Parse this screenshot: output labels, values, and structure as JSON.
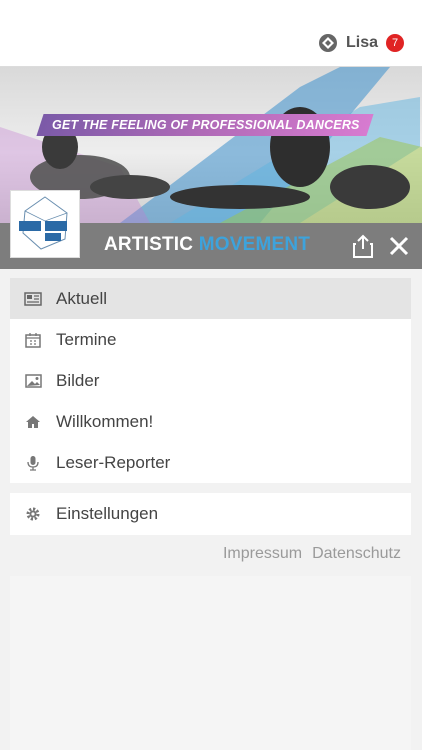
{
  "user": {
    "name": "Lisa",
    "badge": "7"
  },
  "hero": {
    "tagline": "GET THE FEELING OF PROFESSIONAL DANCERS"
  },
  "brand": {
    "part1": "ARTISTIC",
    "part2": "MOVEMENT"
  },
  "menu": {
    "items": [
      {
        "label": "Aktuell",
        "icon": "newspaper-icon"
      },
      {
        "label": "Termine",
        "icon": "calendar-icon"
      },
      {
        "label": "Bilder",
        "icon": "image-icon"
      },
      {
        "label": "Willkommen!",
        "icon": "home-icon"
      },
      {
        "label": "Leser-Reporter",
        "icon": "microphone-icon"
      }
    ],
    "settings": {
      "label": "Einstellungen",
      "icon": "gear-icon"
    }
  },
  "footer": {
    "impressum": "Impressum",
    "datenschutz": "Datenschutz"
  },
  "colors": {
    "accent": "#3da3dc",
    "badge": "#e02424",
    "brandbar": "#7d7d7d"
  }
}
